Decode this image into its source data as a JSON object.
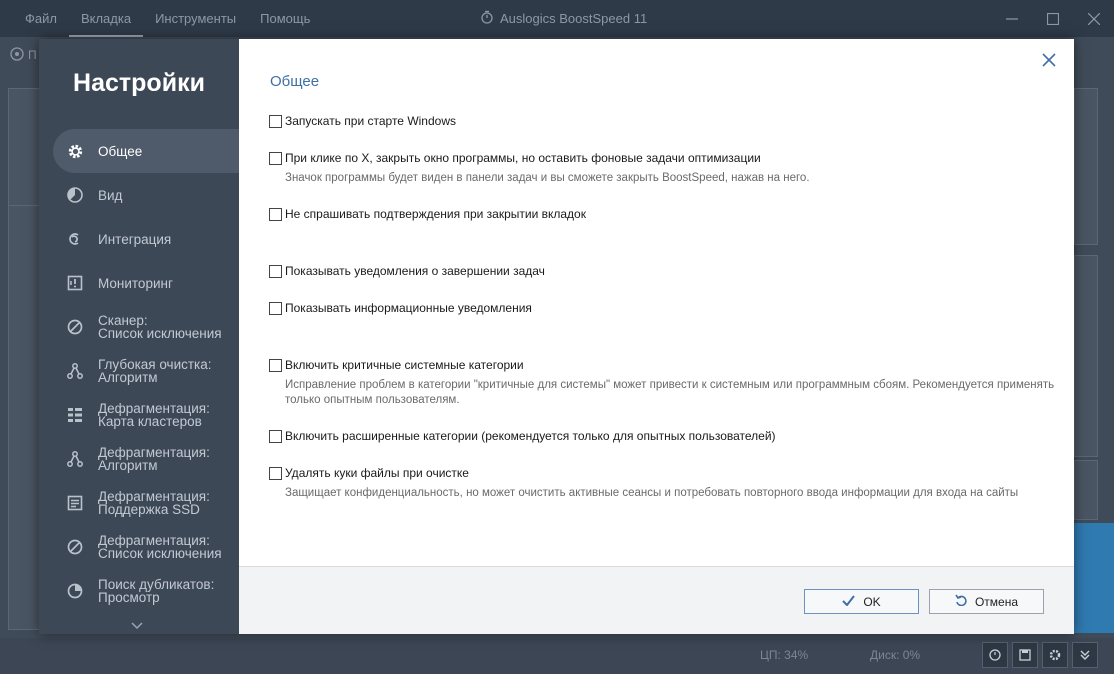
{
  "app": {
    "title": "Auslogics BoostSpeed 11",
    "menu": [
      "Файл",
      "Вкладка",
      "Инструменты",
      "Помощь"
    ],
    "toolbar_fragment": "П"
  },
  "status": {
    "cpu": "ЦП: 34%",
    "disk": "Диск: 0%"
  },
  "settings": {
    "title": "Настройки",
    "nav": [
      {
        "label1": "Общее",
        "label2": "",
        "icon": "gear-icon",
        "active": true
      },
      {
        "label1": "Вид",
        "label2": "",
        "icon": "palette-icon",
        "active": false
      },
      {
        "label1": "Интеграция",
        "label2": "",
        "icon": "integration-icon",
        "active": false
      },
      {
        "label1": "Мониторинг",
        "label2": "",
        "icon": "monitor-icon",
        "active": false
      },
      {
        "label1": "Сканер:",
        "label2": "Список исключения",
        "icon": "block-icon",
        "active": false
      },
      {
        "label1": "Глубокая очистка:",
        "label2": "Алгоритм",
        "icon": "algorithm-icon",
        "active": false
      },
      {
        "label1": "Дефрагментация:",
        "label2": "Карта кластеров",
        "icon": "cluster-map-icon",
        "active": false
      },
      {
        "label1": "Дефрагментация:",
        "label2": "Алгоритм",
        "icon": "algorithm-icon",
        "active": false
      },
      {
        "label1": "Дефрагментация:",
        "label2": "Поддержка SSD",
        "icon": "ssd-icon",
        "active": false
      },
      {
        "label1": "Дефрагментация:",
        "label2": "Список исключения",
        "icon": "block-icon",
        "active": false
      },
      {
        "label1": "Поиск дубликатов:",
        "label2": "Просмотр",
        "icon": "view-icon",
        "active": false
      }
    ],
    "section_title": "Общее",
    "options": [
      {
        "label": "Запускать при старте Windows",
        "desc": "",
        "checked": false
      },
      {
        "label": "При клике по X, закрыть окно программы, но оставить фоновые задачи оптимизации",
        "desc": "Значок программы будет виден в панели задач и вы сможете закрыть BoostSpeed, нажав на него.",
        "checked": false
      },
      {
        "label": "Не спрашивать подтверждения при закрытии вкладок",
        "desc": "",
        "checked": false
      },
      {
        "label": "Показывать уведомления о завершении задач",
        "desc": "",
        "checked": false
      },
      {
        "label": "Показывать информационные уведомления",
        "desc": "",
        "checked": false
      },
      {
        "label": "Включить критичные системные категории",
        "desc": "Исправление проблем в категории \"критичные для системы\" может привести к системным или программным сбоям. Рекомендуется применять только опытным пользователям.",
        "checked": false
      },
      {
        "label": "Включить расширенные категории (рекомендуется только для опытных пользователей)",
        "desc": "",
        "checked": false
      },
      {
        "label": "Удалять куки файлы при очистке",
        "desc": "Защищает конфиденциальность, но может очистить активные сеансы и потребовать повторного ввода информации для входа на сайты",
        "checked": false
      }
    ],
    "ok_label": "OK",
    "cancel_label": "Отмена"
  },
  "colors": {
    "accent": "#3f6fa6",
    "sidebar_bg": "#3d4857",
    "sidebar_active": "#4f5b6b"
  }
}
